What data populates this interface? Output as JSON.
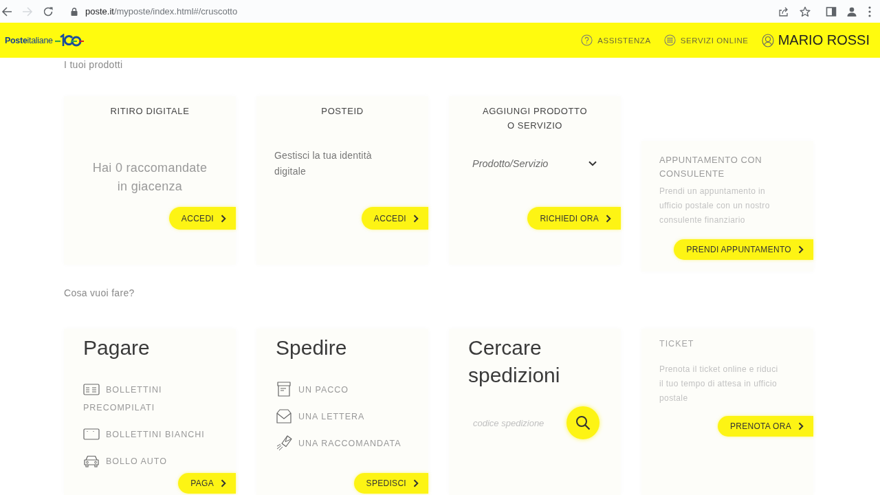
{
  "browser": {
    "forward_disabled": true,
    "url_host": "poste.it",
    "url_path": "/myposte/index.html#/cruscotto"
  },
  "header": {
    "logo": "**Poste**italiane",
    "links": [
      {
        "label": "ASSISTENZA"
      },
      {
        "label": "SERVIZI ONLINE"
      }
    ],
    "user": "MARIO ROSSI"
  },
  "products": {
    "heading": "I tuoi prodotti",
    "cards": [
      {
        "kind": "message",
        "title": "RITIRO DIGITALE",
        "text": "Hai 0 raccomandate in giacenza",
        "button": "ACCEDI"
      },
      {
        "kind": "text",
        "title": "POSTEID",
        "text": "Gestisci la tua identità digitale",
        "button": "ACCEDI"
      },
      {
        "kind": "select",
        "title": "AGGIUNGI PRODOTTO O SERVIZIO",
        "placeholder": "Prodotto/Servizio",
        "button": "RICHIEDI ORA"
      },
      {
        "kind": "info",
        "title": "APPUNTAMENTO CON CONSULENTE",
        "text": "Prendi un appuntamento in ufficio postale con un nostro consulente finanziario",
        "button": "PRENDI APPUNTAMENTO"
      }
    ]
  },
  "actions": {
    "heading": "Cosa vuoi fare?",
    "cards": [
      {
        "kind": "list",
        "title": "Pagare",
        "items": [
          "BOLLETTINI PRECOMPILATI",
          "BOLLETTINI BIANCHI",
          "BOLLO AUTO"
        ],
        "button": "PAGA"
      },
      {
        "kind": "list",
        "title": "Spedire",
        "items": [
          "UN PACCO",
          "UNA LETTERA",
          "UNA RACCOMANDATA"
        ],
        "button": "SPEDISCI"
      },
      {
        "kind": "search",
        "title": "Cercare spedizioni",
        "placeholder": "codice spedizione"
      },
      {
        "kind": "info",
        "title": "TICKET",
        "text": "Prenota il ticket online e riduci il tuo tempo di attesa in ufficio postale",
        "button": "PRENOTA ORA"
      }
    ]
  }
}
